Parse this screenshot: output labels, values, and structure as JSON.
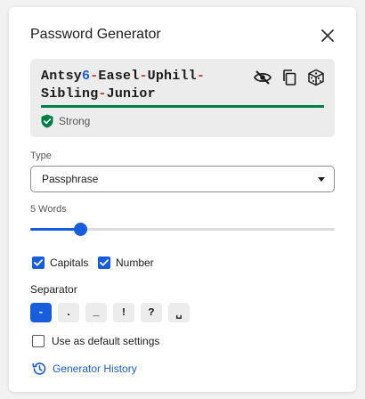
{
  "header": {
    "title": "Password Generator",
    "close_icon": "close-icon"
  },
  "password": {
    "parts": [
      {
        "text": "Antsy",
        "kind": "word"
      },
      {
        "text": "6",
        "kind": "num"
      },
      {
        "text": "-",
        "kind": "sep"
      },
      {
        "text": "Easel",
        "kind": "word"
      },
      {
        "text": "-",
        "kind": "sep"
      },
      {
        "text": "Uphill",
        "kind": "word"
      },
      {
        "text": "-",
        "kind": "sep"
      },
      {
        "text": "Sibling",
        "kind": "word"
      },
      {
        "text": "-",
        "kind": "sep"
      },
      {
        "text": "Junior",
        "kind": "word"
      }
    ],
    "icons": [
      "eye-off-icon",
      "copy-icon",
      "dice-icon"
    ],
    "strength": {
      "label": "Strong",
      "color": "#017e45",
      "level": 1.0
    }
  },
  "type": {
    "label": "Type",
    "value": "Passphrase"
  },
  "words": {
    "label": "5 Words",
    "value": 5,
    "fraction": 0.165
  },
  "options": {
    "capitals": {
      "label": "Capitals",
      "checked": true
    },
    "number": {
      "label": "Number",
      "checked": true
    }
  },
  "separator": {
    "label": "Separator",
    "options": [
      "-",
      ".",
      "_",
      "!",
      "?",
      "␣"
    ],
    "selected": "-"
  },
  "default_settings": {
    "label": "Use as default settings",
    "checked": false
  },
  "history": {
    "label": "Generator History"
  },
  "colors": {
    "accent": "#175ddc",
    "number": "#175ddc",
    "separator": "#c83522",
    "strong": "#017e45"
  }
}
